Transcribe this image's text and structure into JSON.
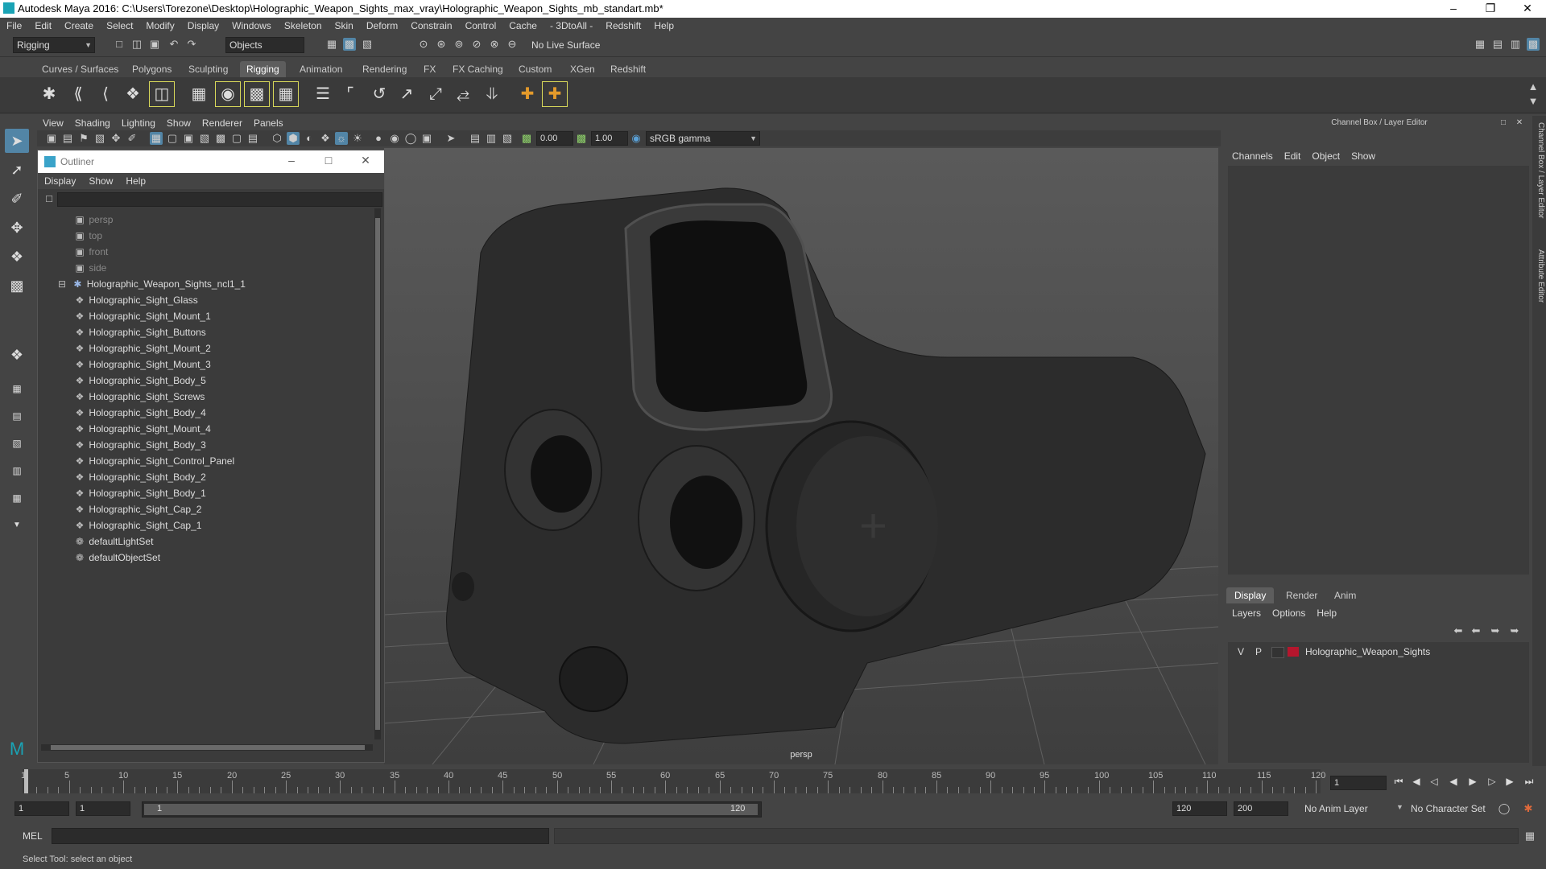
{
  "window": {
    "title": "Autodesk Maya 2016: C:\\Users\\Torezone\\Desktop\\Holographic_Weapon_Sights_max_vray\\Holographic_Weapon_Sights_mb_standart.mb*"
  },
  "menubar": [
    "File",
    "Edit",
    "Create",
    "Select",
    "Modify",
    "Display",
    "Windows",
    "Skeleton",
    "Skin",
    "Deform",
    "Constrain",
    "Control",
    "Cache",
    "- 3DtoAll -",
    "Redshift",
    "Help"
  ],
  "statusline": {
    "menuset": "Rigging",
    "select_mode": "Objects",
    "live_surface": "No Live Surface"
  },
  "shelf_tabs": [
    "Curves / Surfaces",
    "Polygons",
    "Sculpting",
    "Rigging",
    "Animation",
    "Rendering",
    "FX",
    "FX Caching",
    "Custom",
    "XGen",
    "Redshift"
  ],
  "active_shelf": "Rigging",
  "panel": {
    "menus": [
      "View",
      "Shading",
      "Lighting",
      "Show",
      "Renderer",
      "Panels"
    ],
    "exposure": "0.00",
    "gamma": "1.00",
    "color_space": "sRGB gamma",
    "camera": "persp"
  },
  "outliner": {
    "title": "Outliner",
    "menus": [
      "Display",
      "Show",
      "Help"
    ],
    "cameras": [
      "persp",
      "top",
      "front",
      "side"
    ],
    "group": "Holographic_Weapon_Sights_ncl1_1",
    "children": [
      "Holographic_Sight_Glass",
      "Holographic_Sight_Mount_1",
      "Holographic_Sight_Buttons",
      "Holographic_Sight_Mount_2",
      "Holographic_Sight_Mount_3",
      "Holographic_Sight_Body_5",
      "Holographic_Sight_Screws",
      "Holographic_Sight_Body_4",
      "Holographic_Sight_Mount_4",
      "Holographic_Sight_Body_3",
      "Holographic_Sight_Control_Panel",
      "Holographic_Sight_Body_2",
      "Holographic_Sight_Body_1",
      "Holographic_Sight_Cap_2",
      "Holographic_Sight_Cap_1"
    ],
    "sets": [
      "defaultLightSet",
      "defaultObjectSet"
    ]
  },
  "channelbox": {
    "title": "Channel Box / Layer Editor",
    "menus": [
      "Channels",
      "Edit",
      "Object",
      "Show"
    ],
    "layer_tabs": [
      "Display",
      "Render",
      "Anim"
    ],
    "layer_menus": [
      "Layers",
      "Options",
      "Help"
    ],
    "layer": {
      "v": "V",
      "p": "P",
      "name": "Holographic_Weapon_Sights",
      "color": "#b5162d"
    },
    "side_tabs": [
      "Channel Box / Layer Editor",
      "Attribute Editor"
    ]
  },
  "timeline": {
    "ticks": [
      1,
      5,
      10,
      15,
      20,
      25,
      30,
      35,
      40,
      45,
      50,
      55,
      60,
      65,
      70,
      75,
      80,
      85,
      90,
      95,
      100,
      105,
      110,
      115,
      120
    ],
    "current_frame": "1"
  },
  "range": {
    "start": "1",
    "playback_start": "1",
    "slider_start": "1",
    "slider_end": "120",
    "playback_end": "120",
    "end": "200",
    "anim_layer": "No Anim Layer",
    "character_set": "No Character Set"
  },
  "cmdline": {
    "label": "MEL"
  },
  "helpline": {
    "text": "Select Tool: select an object"
  },
  "colors": {
    "accent": "#5285a6",
    "layer": "#b5162d"
  }
}
